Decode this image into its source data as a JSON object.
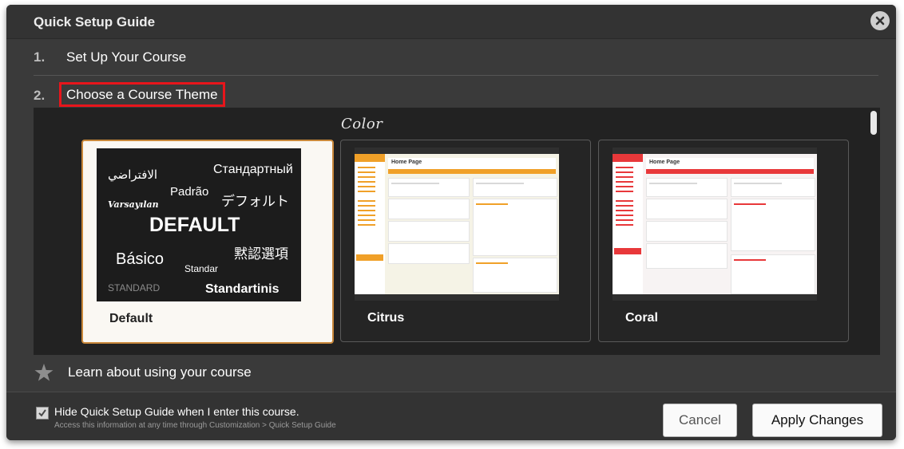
{
  "dialog": {
    "title": "Quick Setup Guide"
  },
  "steps": [
    {
      "number": "1.",
      "label": "Set Up Your Course"
    },
    {
      "number": "2.",
      "label": "Choose a Course Theme"
    }
  ],
  "themes": {
    "heading": "Color",
    "cards": [
      {
        "name": "Default",
        "selected": true
      },
      {
        "name": "Citrus",
        "selected": false,
        "accent": "#f0a028",
        "background": "#9ed43a"
      },
      {
        "name": "Coral",
        "selected": false,
        "accent": "#e8383a",
        "background": "#ef4a44"
      }
    ],
    "default_words": [
      "الافتراضي",
      "Стандартный",
      "Padrão",
      "デフォルト",
      "Varsayılan",
      "DEFAULT",
      "黙認選項",
      "Básico",
      "Standar",
      "STANDARD",
      "Standartinis"
    ],
    "preview": {
      "page_title": "Home Page"
    }
  },
  "learn": {
    "label": "Learn about using your course"
  },
  "footer": {
    "checkbox_label": "Hide Quick Setup Guide when I enter this course.",
    "checkbox_checked": true,
    "sub_text": "Access this information at any time through Customization > Quick Setup Guide",
    "cancel_label": "Cancel",
    "apply_label": "Apply Changes"
  },
  "icons": {
    "close": "close-icon",
    "star": "star-icon",
    "check": "check-icon"
  },
  "colors": {
    "highlight_border": "#e8151b",
    "selected_border": "#c9883a"
  }
}
